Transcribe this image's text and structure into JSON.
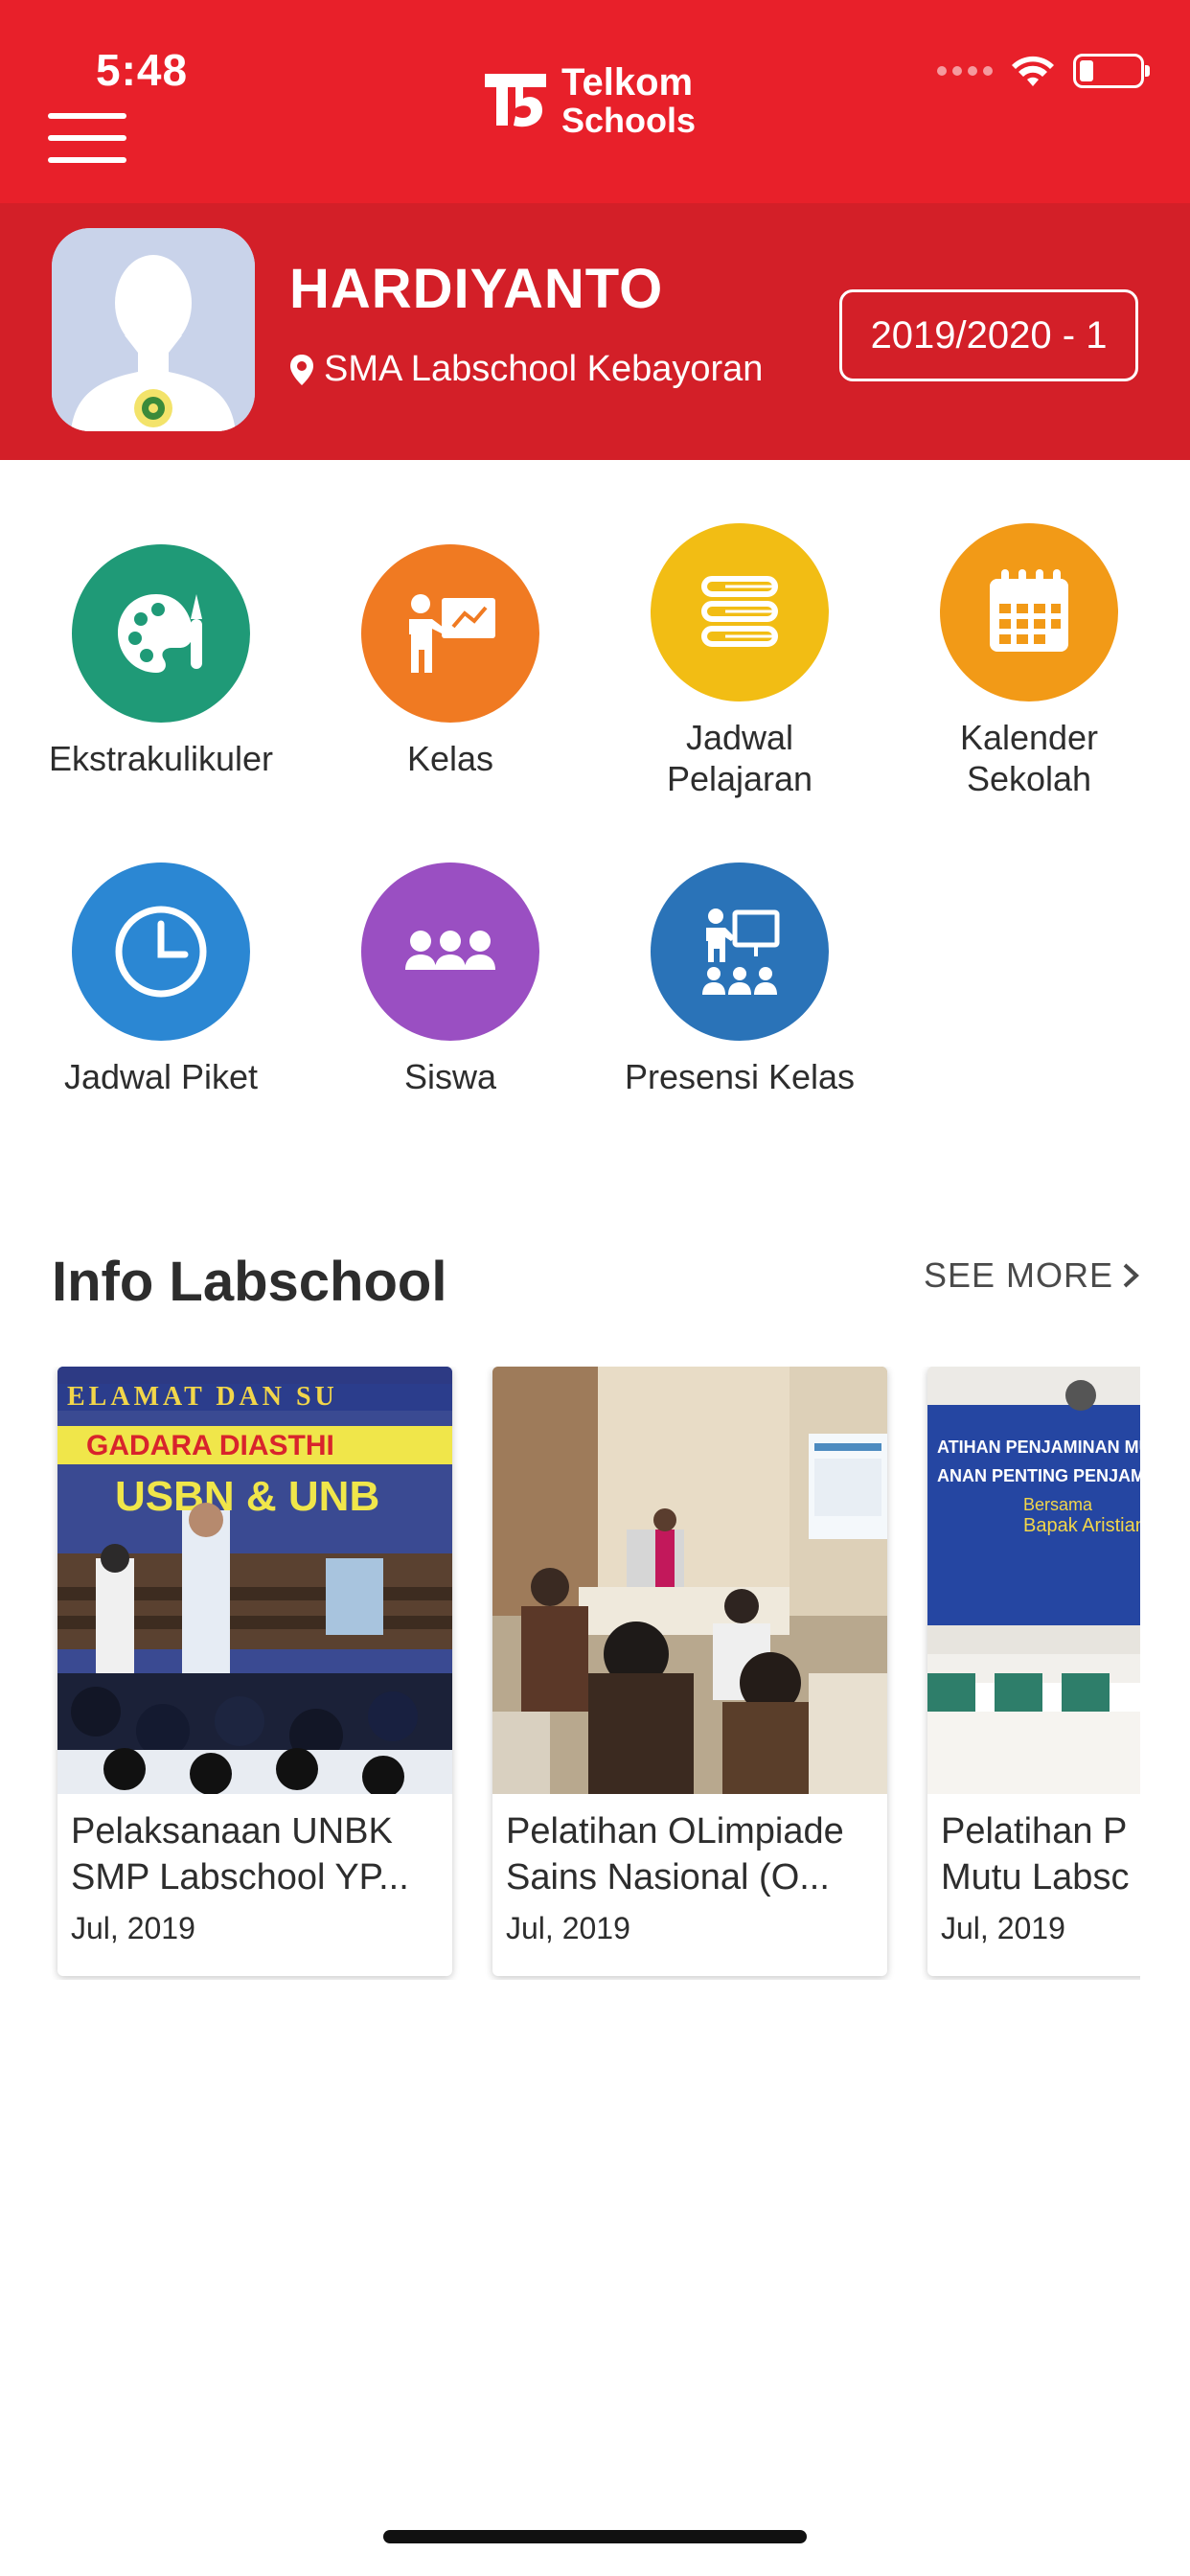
{
  "status_bar": {
    "time": "5:48"
  },
  "header": {
    "logo_line1": "Telkom",
    "logo_line2": "Schools"
  },
  "profile": {
    "name": "HARDIYANTO",
    "school": "SMA Labschool Kebayoran",
    "academic_year": "2019/2020 - 1"
  },
  "menu": [
    {
      "label": "Ekstrakulikuler",
      "icon": "palette-icon",
      "color": "#1f9a77"
    },
    {
      "label": "Kelas",
      "icon": "teacher-board-icon",
      "color": "#f07a22"
    },
    {
      "label": "Jadwal\nPelajaran",
      "icon": "books-stack-icon",
      "color": "#f2bd14"
    },
    {
      "label": "Kalender\nSekolah",
      "icon": "calendar-icon",
      "color": "#f29a17"
    },
    {
      "label": "Jadwal Piket",
      "icon": "clock-icon",
      "color": "#2b87d3"
    },
    {
      "label": "Siswa",
      "icon": "students-group-icon",
      "color": "#9a4fc2"
    },
    {
      "label": "Presensi Kelas",
      "icon": "class-presence-icon",
      "color": "#2a73b8"
    }
  ],
  "info": {
    "title": "Info Labschool",
    "see_more": "SEE MORE",
    "cards": [
      {
        "title_line1": "Pelaksanaan UNBK",
        "title_line2": "SMP Labschool YP...",
        "date": "Jul, 2019"
      },
      {
        "title_line1": "Pelatihan OLimpiade",
        "title_line2": "Sains Nasional (O...",
        "date": "Jul, 2019"
      },
      {
        "title_line1": "Pelatihan P",
        "title_line2": "Mutu Labsc",
        "date": "Jul, 2019"
      }
    ]
  },
  "colors": {
    "header_red": "#e8202a",
    "profile_red": "#d31f28"
  }
}
